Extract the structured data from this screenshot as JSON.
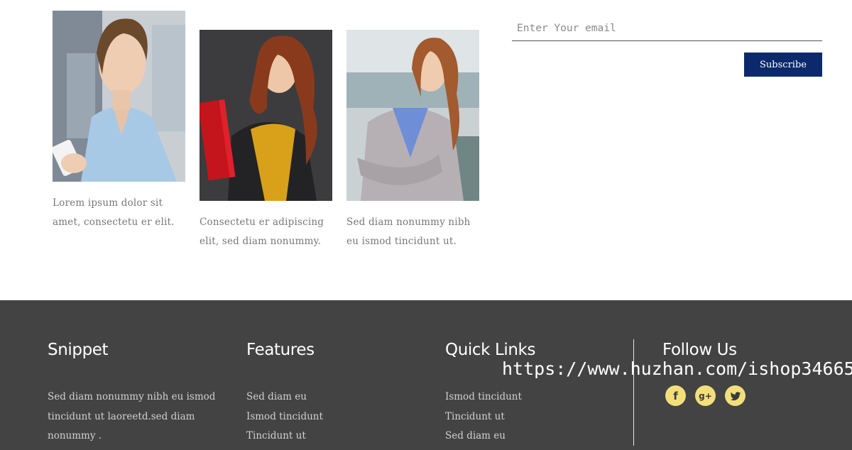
{
  "cards": [
    {
      "text": "Lorem ipsum dolor sit amet, consectetu er elit."
    },
    {
      "text": "Consectetu er adipiscing elit, sed diam nonummy."
    },
    {
      "text": "Sed diam nonummy nibh eu ismod tincidunt ut."
    }
  ],
  "newsletter": {
    "placeholder": "Enter Your email",
    "button_label": "Subscribe"
  },
  "footer": {
    "snippet": {
      "title": "Snippet",
      "text": "Sed diam nonummy nibh eu ismod tincidunt ut laoreetd.sed diam nonummy ."
    },
    "features": {
      "title": "Features",
      "items": [
        "Sed diam eu",
        "Ismod tincidunt",
        "Tincidunt ut"
      ]
    },
    "quick_links": {
      "title": "Quick Links",
      "items": [
        "Ismod tincidunt",
        "Tincidunt ut",
        "Sed diam eu"
      ]
    },
    "follow": {
      "title": "Follow Us",
      "icons": [
        "facebook-icon",
        "google-plus-icon",
        "twitter-icon"
      ],
      "icon_bg": "#f2df7a"
    }
  },
  "watermark": "https://www.huzhan.com/ishop34665",
  "colors": {
    "footer_bg": "#434343",
    "button_bg": "#0c2a6b"
  }
}
